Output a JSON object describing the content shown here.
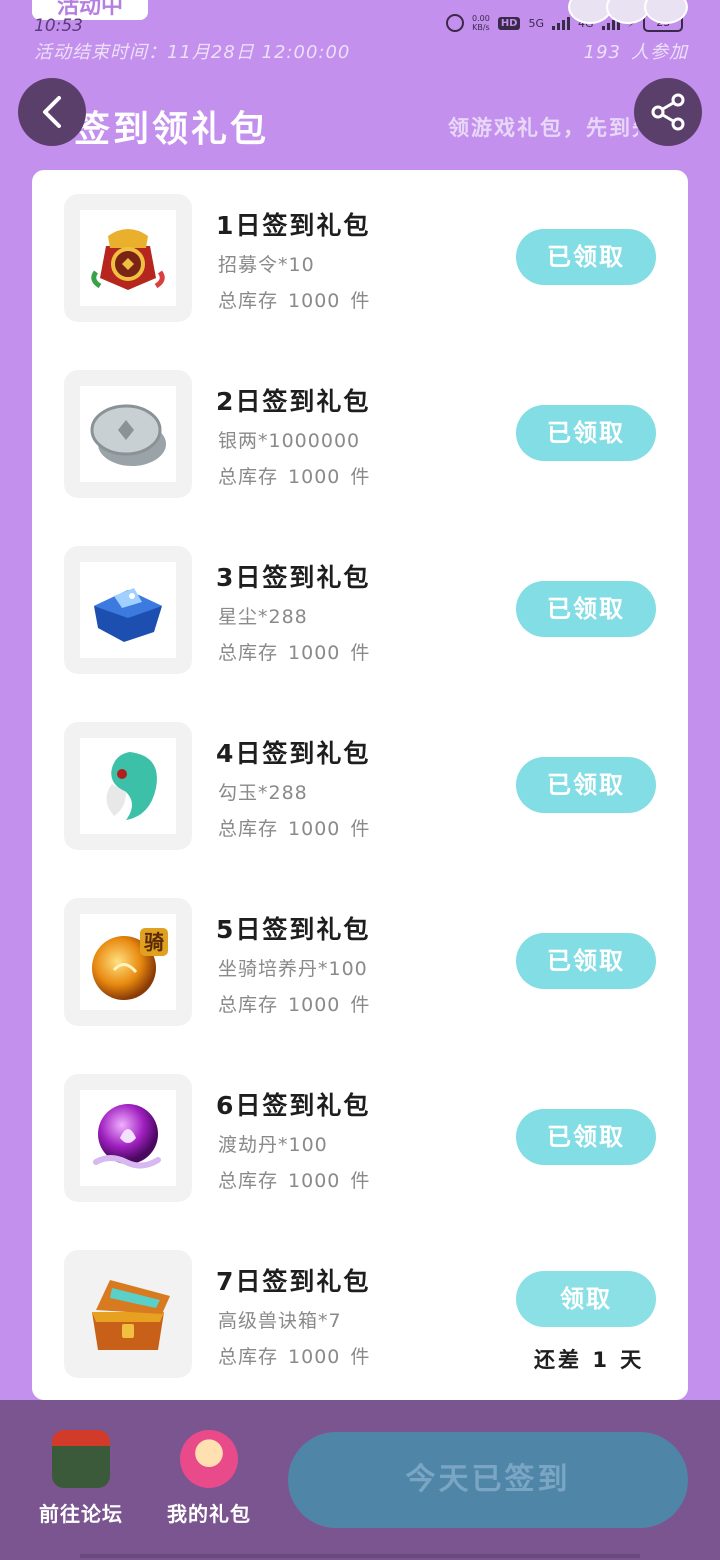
{
  "status_bar": {
    "active_tag": "活动中",
    "time": "10:53",
    "net_speed": "0.00",
    "net_unit": "KB/s",
    "hd": "HD",
    "net_5g": "5G",
    "net_4g": "4G",
    "battery": "23"
  },
  "activity": {
    "end_time": "活动结束时间：11月28日 12:00:00",
    "participants": "193",
    "participants_suffix": "人参加"
  },
  "header": {
    "title": "签到领礼包",
    "slogan": "领游戏礼包，先到先得"
  },
  "gifts": [
    {
      "name": "1日签到礼包",
      "item": "招募令*10",
      "stock_prefix": "总库存",
      "stock": "1000",
      "stock_unit": "件",
      "button": "已领取",
      "icon": "recruit-token-icon"
    },
    {
      "name": "2日签到礼包",
      "item": "银两*1000000",
      "stock_prefix": "总库存",
      "stock": "1000",
      "stock_unit": "件",
      "button": "已领取",
      "icon": "silver-coin-icon"
    },
    {
      "name": "3日签到礼包",
      "item": "星尘*288",
      "stock_prefix": "总库存",
      "stock": "1000",
      "stock_unit": "件",
      "button": "已领取",
      "icon": "stardust-icon"
    },
    {
      "name": "4日签到礼包",
      "item": "勾玉*288",
      "stock_prefix": "总库存",
      "stock": "1000",
      "stock_unit": "件",
      "button": "已领取",
      "icon": "magatama-icon"
    },
    {
      "name": "5日签到礼包",
      "item": "坐骑培养丹*100",
      "stock_prefix": "总库存",
      "stock": "1000",
      "stock_unit": "件",
      "button": "已领取",
      "icon": "mount-pill-icon"
    },
    {
      "name": "6日签到礼包",
      "item": "渡劫丹*100",
      "stock_prefix": "总库存",
      "stock": "1000",
      "stock_unit": "件",
      "button": "已领取",
      "icon": "tribulation-pill-icon"
    },
    {
      "name": "7日签到礼包",
      "item": "高级兽诀箱*7",
      "stock_prefix": "总库存",
      "stock": "1000",
      "stock_unit": "件",
      "button": "领取",
      "icon": "treasure-chest-icon",
      "remain_prefix": "还差",
      "remain_days": "1",
      "remain_unit": "天"
    }
  ],
  "mount_badge": "骑",
  "bottom": {
    "forum_label": "前往论坛",
    "my_gifts_label": "我的礼包",
    "signed_label": "今天已签到"
  },
  "colors": {
    "background": "#c490ee",
    "button_cyan": "#82dde4",
    "bottom_bar": "#7b5590",
    "signed_button": "#4f86a8"
  }
}
